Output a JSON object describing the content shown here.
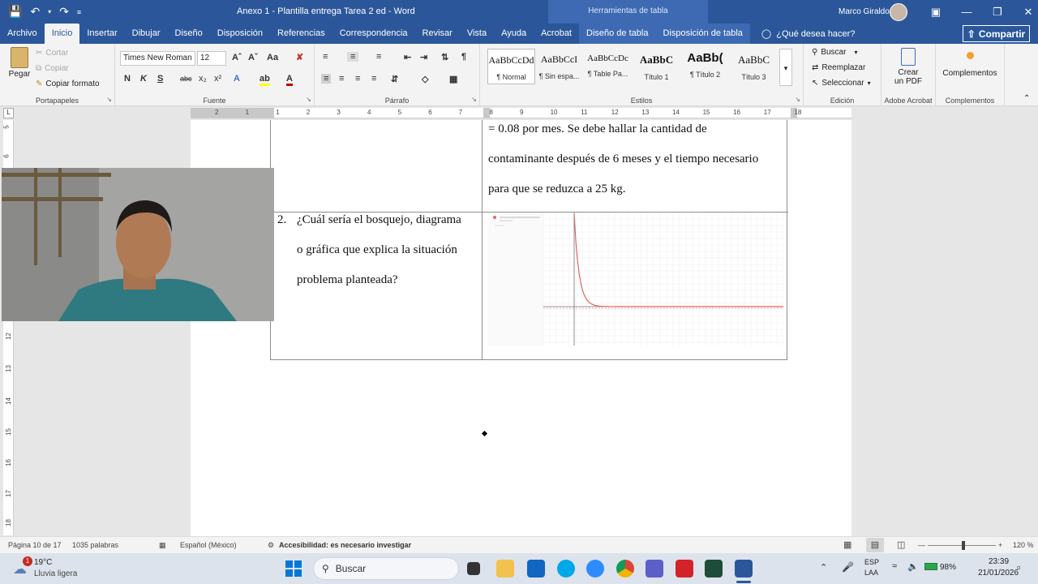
{
  "titlebar": {
    "doc_title": "Anexo 1 - Plantilla entrega Tarea 2 ed  -  Word",
    "context_tools": "Herramientas de tabla",
    "user_name": "Marco Giraldo"
  },
  "tabs": [
    "Archivo",
    "Inicio",
    "Insertar",
    "Dibujar",
    "Diseño",
    "Disposición",
    "Referencias",
    "Correspondencia",
    "Revisar",
    "Vista",
    "Ayuda",
    "Acrobat"
  ],
  "context_tabs": [
    "Diseño de tabla",
    "Disposición de tabla"
  ],
  "tell_me": "¿Qué desea hacer?",
  "share": "Compartir",
  "clipboard": {
    "paste": "Pegar",
    "cut": "Cortar",
    "copy": "Copiar",
    "format_painter": "Copiar formato",
    "label": "Portapapeles"
  },
  "font": {
    "family": "Times New Roman",
    "size": "12",
    "label": "Fuente"
  },
  "paragraph": {
    "label": "Párrafo"
  },
  "styles": {
    "label": "Estilos",
    "items": [
      {
        "preview": "AaBbCcDd",
        "name": "¶ Normal"
      },
      {
        "preview": "AaBbCcI",
        "name": "¶ Sin espa..."
      },
      {
        "preview": "AaBbCcDc",
        "name": "¶ Table Pa..."
      },
      {
        "preview": "AaBbC",
        "name": "Título 1"
      },
      {
        "preview": "AaBb(",
        "name": "¶ Título 2"
      },
      {
        "preview": "AaBbC",
        "name": "Título 3"
      }
    ]
  },
  "editing": {
    "find": "Buscar",
    "replace": "Reemplazar",
    "select": "Seleccionar",
    "label": "Edición"
  },
  "acrobat": {
    "create_pdf_line1": "Crear",
    "create_pdf_line2": "un PDF",
    "label": "Adobe Acrobat"
  },
  "addins": {
    "button": "Complementos",
    "label": "Complementos"
  },
  "ruler": {
    "h_labels": [
      "2",
      "1",
      "1",
      "2",
      "3",
      "4",
      "5",
      "6",
      "7",
      "8",
      "9",
      "10",
      "11",
      "12",
      "13",
      "14",
      "15",
      "16",
      "17",
      "18"
    ],
    "v_labels": [
      "5",
      "6",
      "12",
      "13",
      "14",
      "15",
      "16",
      "17",
      "18"
    ]
  },
  "document": {
    "row1_lines": [
      "= 0.08 por mes. Se debe hallar la cantidad de",
      "contaminante después de 6 meses y el tiempo necesario",
      "para que se reduzca a 25 kg."
    ],
    "row2_number": "2.",
    "row2_lines": [
      "¿Cuál sería el bosquejo, diagrama",
      "o gráfica que explica la situación",
      "problema planteada?"
    ]
  },
  "statusbar": {
    "page": "Página 10 de 17",
    "words": "1035 palabras",
    "language": "Español (México)",
    "accessibility": "Accesibilidad: es necesario investigar",
    "zoom": "120 %"
  },
  "taskbar": {
    "weather_temp": "19°C",
    "weather_desc": "Lluvia ligera",
    "weather_badge": "1",
    "search": "Buscar",
    "lang_line1": "ESP",
    "lang_line2": "LAA",
    "battery": "98%",
    "time": "23:39",
    "date": "21/01/2026"
  },
  "colors": {
    "word_blue": "#2b579a",
    "ribbon_bg": "#f3f3f3",
    "curve": "#e06666"
  }
}
